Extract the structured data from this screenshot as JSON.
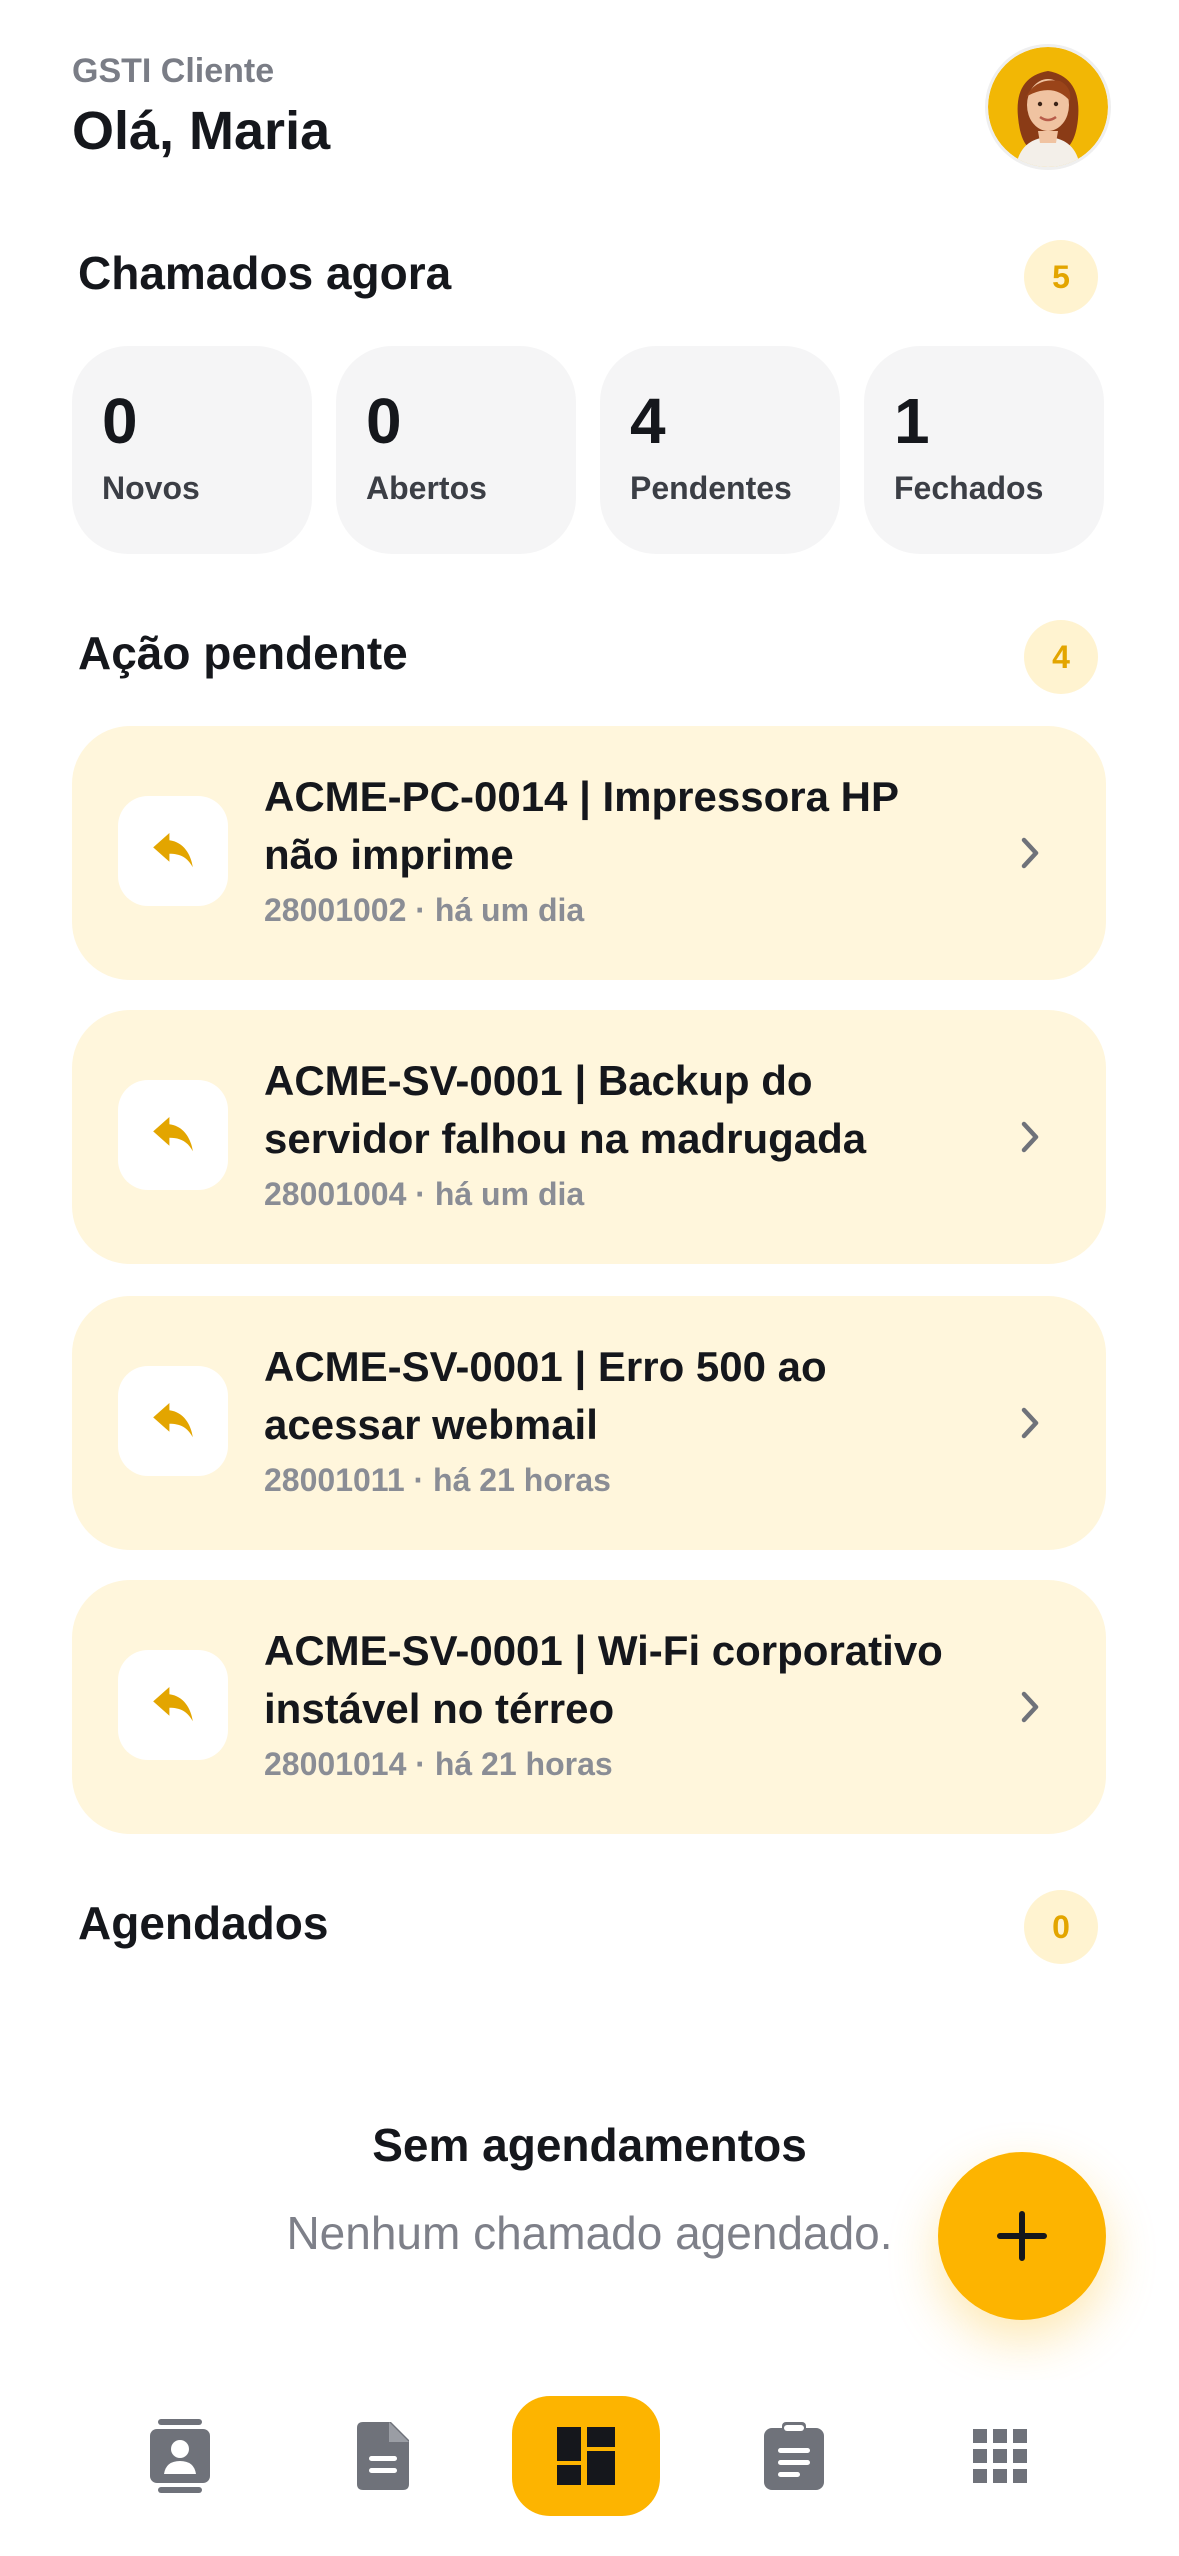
{
  "header": {
    "app_label": "GSTI Cliente",
    "greeting": "Olá, Maria",
    "avatar_icon": "user-avatar"
  },
  "colors": {
    "accent": "#fdb400",
    "badge_bg": "#fff3d0",
    "badge_text": "#e3a500",
    "ticket_bg": "#fff6dc",
    "card_bg": "#f5f5f6"
  },
  "summary": {
    "title": "Chamados agora",
    "count": "5",
    "stats": [
      {
        "value": "0",
        "label": "Novos"
      },
      {
        "value": "0",
        "label": "Abertos"
      },
      {
        "value": "4",
        "label": "Pendentes"
      },
      {
        "value": "1",
        "label": "Fechados"
      }
    ]
  },
  "pending": {
    "title": "Ação pendente",
    "count": "4",
    "icon": "reply-icon",
    "tickets": [
      {
        "title": "ACME-PC-0014 | Impressora HP não imprime",
        "meta": "28001002 · há um dia"
      },
      {
        "title": "ACME-SV-0001 | Backup do servidor falhou na madrugada",
        "meta": "28001004 · há um dia"
      },
      {
        "title": "ACME-SV-0001 | Erro 500 ao acessar webmail",
        "meta": "28001011 · há 21 horas"
      },
      {
        "title": "ACME-SV-0001 | Wi-Fi corporativo instável no térreo",
        "meta": "28001014 · há 21 horas"
      }
    ]
  },
  "scheduled": {
    "title": "Agendados",
    "count": "0",
    "empty_title": "Sem agendamentos",
    "empty_text": "Nenhum chamado agendado."
  },
  "fab": {
    "icon": "plus-icon"
  },
  "bottom_nav": {
    "items": [
      {
        "icon": "contact-card-icon",
        "active": false
      },
      {
        "icon": "document-icon",
        "active": false
      },
      {
        "icon": "dashboard-icon",
        "active": true
      },
      {
        "icon": "clipboard-icon",
        "active": false
      },
      {
        "icon": "apps-grid-icon",
        "active": false
      }
    ]
  }
}
